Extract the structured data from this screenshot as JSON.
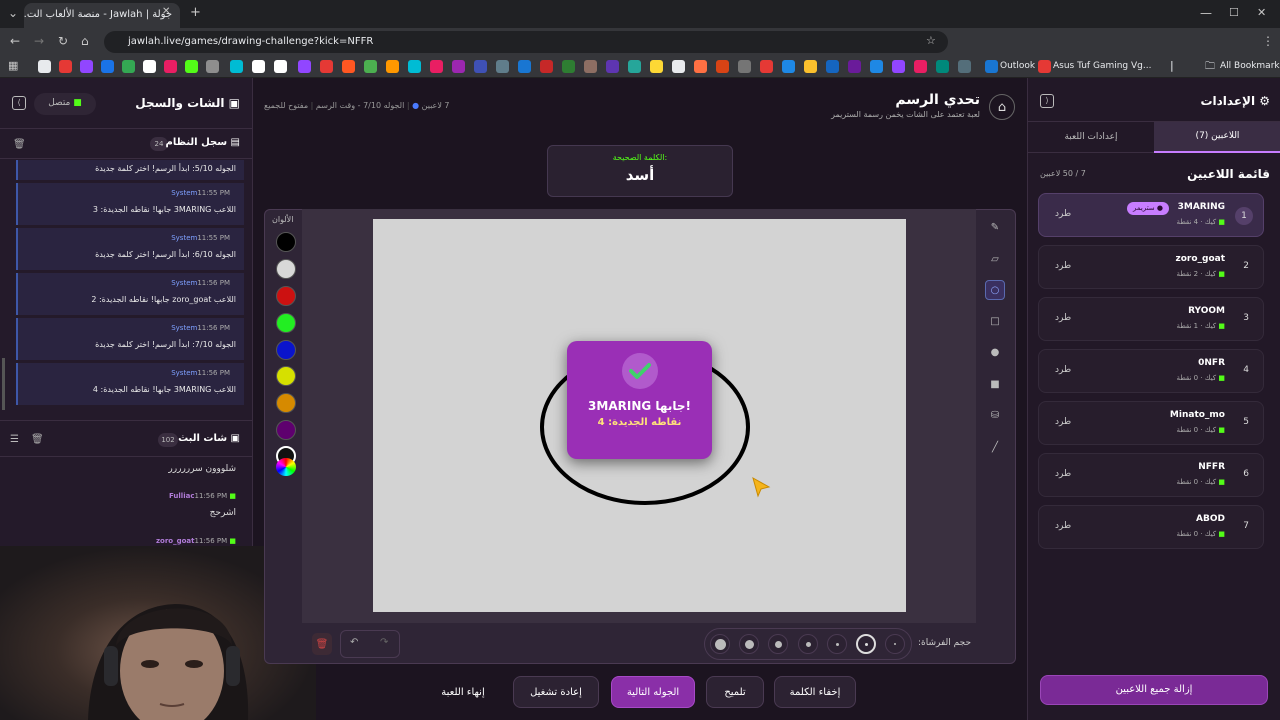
{
  "browser": {
    "tab_title": "جولة | Jawlah - منصة الألعاب الت...",
    "url": "jawlah.live/games/drawing-challenge?kick=NFFR",
    "bookmarks": {
      "outlook": "Outlook",
      "asus": "Asus Tuf Gaming Vg...",
      "all": "All Bookmarks"
    }
  },
  "left_panel": {
    "title": "الشات والسجل",
    "status": "متصل",
    "system_log": {
      "title": "سجل النظام",
      "count": "24",
      "first_partial": "الجوله 5/10: ابدأ الرسم! اختر كلمة جديدة",
      "entries": [
        {
          "sender": "System",
          "time": "11:55 PM",
          "text": "اللاعب 3MARING جابها! نقاطه الجديدة: 3"
        },
        {
          "sender": "System",
          "time": "11:55 PM",
          "text": "الجوله 6/10: ابدأ الرسم! اختر كلمة جديدة"
        },
        {
          "sender": "System",
          "time": "11:56 PM",
          "text": "اللاعب zoro_goat جابها! نقاطه الجديدة: 2"
        },
        {
          "sender": "System",
          "time": "11:56 PM",
          "text": "الجوله 7/10: ابدأ الرسم! اختر كلمة جديدة"
        },
        {
          "sender": "System",
          "time": "11:56 PM",
          "text": "اللاعب 3MARING جابها! نقاطه الجديدة: 4"
        }
      ]
    },
    "stream_chat": {
      "title": "شات البث",
      "count": "102",
      "messages": [
        {
          "text": "شلووون سرررررر"
        },
        {
          "user": "Fulliac",
          "time": "11:56 PM",
          "text": "اشرحج"
        },
        {
          "user": "zoro_goat",
          "time": "11:56 PM",
          "text": ""
        }
      ]
    }
  },
  "game": {
    "title": "تحدي الرسم",
    "subtitle": "لعبة تعتمد على الشات يخمن رسمة الستريمر",
    "players_count": "7 لاعبين",
    "round_info": "الجوله 7/10 - وقت الرسم",
    "open_to_all": "مفتوح للجميع",
    "word_label": "الكلمة الصحيحة:",
    "word": "أسد",
    "colors_label": "الألوان",
    "colors": [
      "#000000",
      "#d8d8d8",
      "#cc1111",
      "#22ee22",
      "#0a14cc",
      "#d6e000",
      "#d68a00",
      "#5e006e",
      "#111111"
    ],
    "popup_title": "3MARING جابها!",
    "popup_sub": "نقاطه الجديدة: 4",
    "brush_label": "حجم الفرشاة:",
    "buttons": {
      "hide": "إخفاء الكلمة",
      "hint": "تلميح",
      "next": "الجوله التالية",
      "restart": "إعادة تشغيل",
      "end": "إنهاء اللعبة"
    }
  },
  "settings": {
    "title": "الإعدادات",
    "tab_players": "اللاعبين (7)",
    "tab_game": "إعدادات اللعبة",
    "list_title": "قائمة اللاعبين",
    "count": "7 / 50 لاعبين",
    "streamer_badge": "● ستريمر",
    "kick_label": "طرد",
    "players": [
      {
        "rank": "1",
        "name": "3MARING",
        "sub": "كيك · 4 نقطة"
      },
      {
        "rank": "2",
        "name": "zoro_goat",
        "sub": "كيك · 2 نقطة"
      },
      {
        "rank": "3",
        "name": "RYOOM",
        "sub": "كيك · 1 نقطة"
      },
      {
        "rank": "4",
        "name": "0NFR",
        "sub": "كيك · 0 نقطة"
      },
      {
        "rank": "5",
        "name": "Minato_mo",
        "sub": "كيك · 0 نقطة"
      },
      {
        "rank": "6",
        "name": "NFFR",
        "sub": "كيك · 0 نقطة"
      },
      {
        "rank": "7",
        "name": "ABOD",
        "sub": "كيك · 0 نقطة"
      }
    ],
    "remove_all": "إزالة جميع اللاعبين"
  }
}
